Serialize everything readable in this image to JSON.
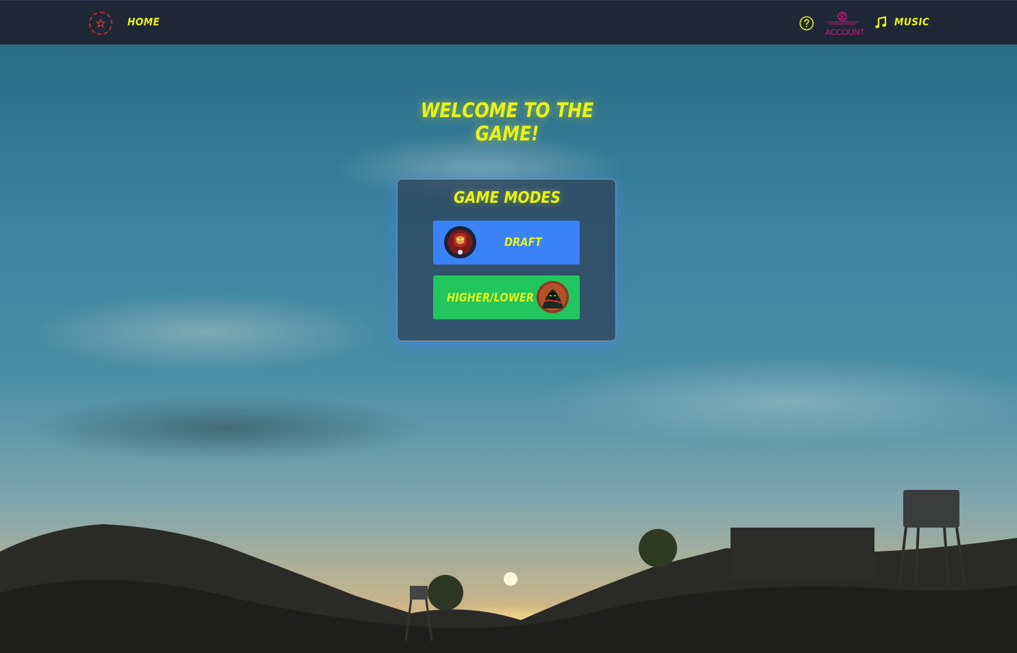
{
  "nav": {
    "home_label": "HOME",
    "account_label": "ACCOUNT",
    "music_label": "MUSIC",
    "icons": [
      "logo-icon",
      "help-icon",
      "account-icon",
      "music-icon"
    ]
  },
  "main": {
    "welcome_title": "WELCOME TO THE GAME!",
    "panel_title": "GAME MODES",
    "modes": [
      {
        "label": "DRAFT",
        "color": "#3b82f6",
        "avatar": "iron-man-avatar"
      },
      {
        "label": "HIGHER/LOWER",
        "color": "#22c55e",
        "avatar": "spawn-avatar"
      }
    ]
  },
  "colors": {
    "accent_text": "#e8f21a",
    "topbar": "#1f2737",
    "account_text": "#d01a78"
  }
}
